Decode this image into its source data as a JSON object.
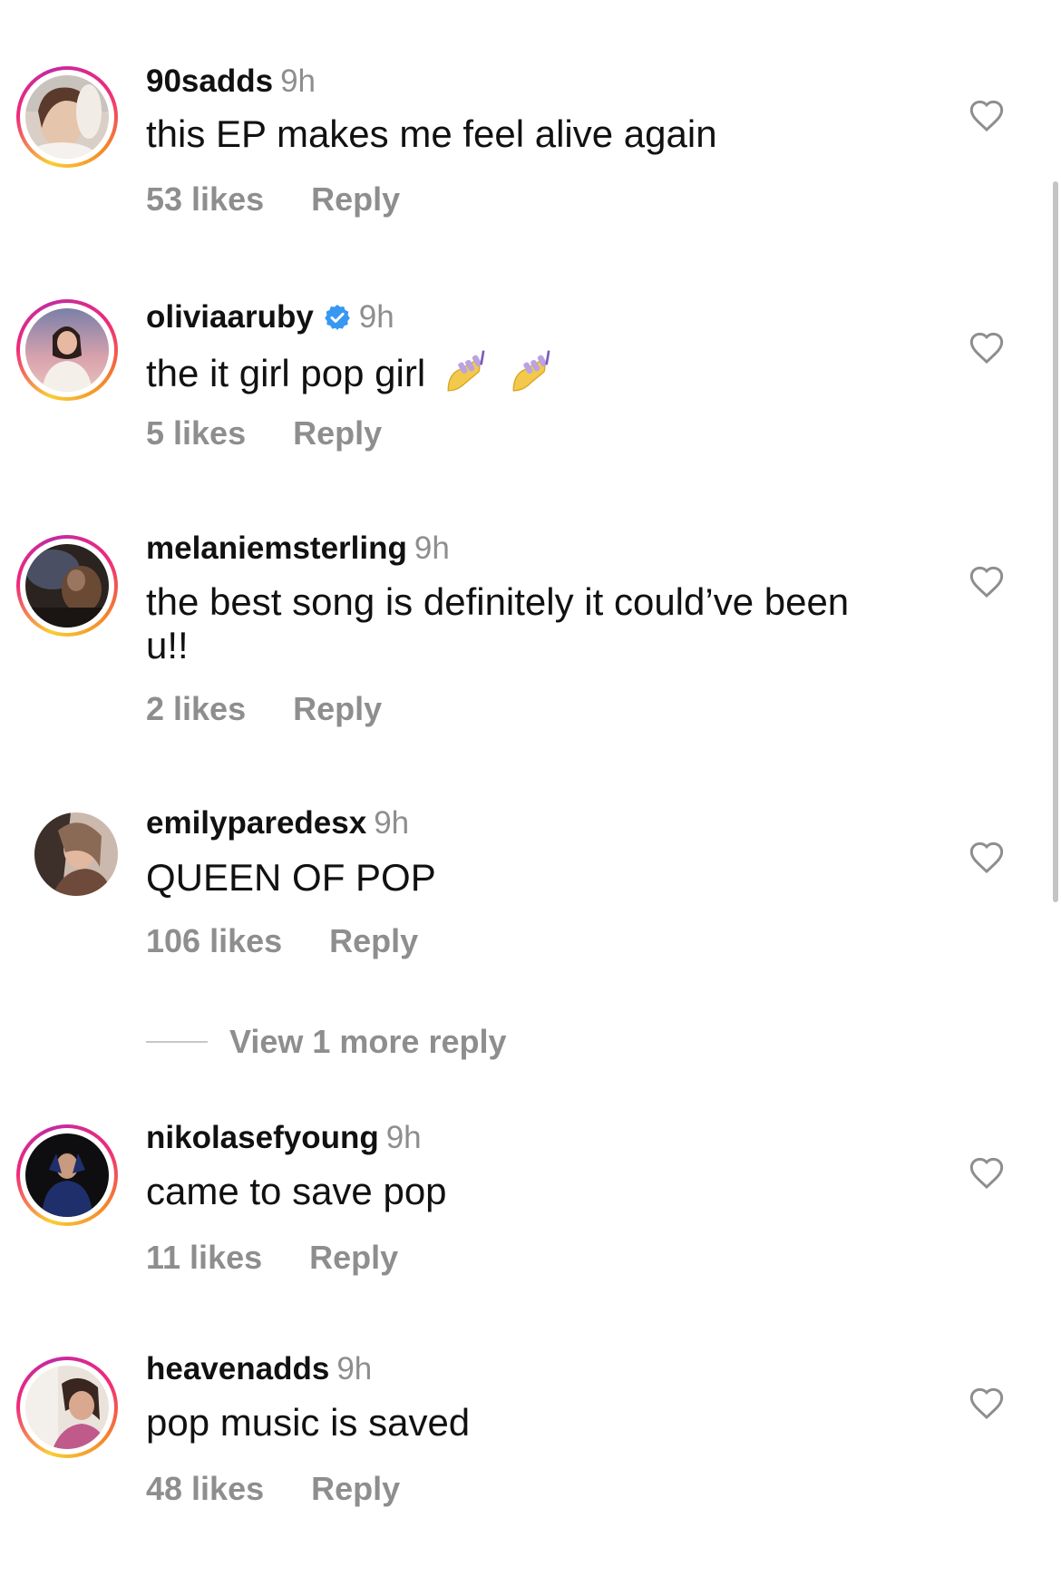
{
  "comments": [
    {
      "username": "90sadds",
      "time": "9h",
      "verified": false,
      "text": "this EP makes me feel alive again",
      "likes": "53 likes",
      "reply": "Reply",
      "story_ring": true
    },
    {
      "username": "oliviaaruby",
      "time": "9h",
      "verified": true,
      "text": "the it girl pop girl",
      "emoji": [
        "nail-polish-icon",
        "nail-polish-icon"
      ],
      "likes": "5 likes",
      "reply": "Reply",
      "story_ring": true
    },
    {
      "username": "melaniemsterling",
      "time": "9h",
      "verified": false,
      "text": "the best song is definitely it could’ve been u!!",
      "likes": "2 likes",
      "reply": "Reply",
      "story_ring": true
    },
    {
      "username": "emilyparedesx",
      "time": "9h",
      "verified": false,
      "text": "QUEEN OF POP",
      "likes": "106 likes",
      "reply": "Reply",
      "story_ring": false,
      "view_more": "View 1 more reply"
    },
    {
      "username": "nikolasefyoung",
      "time": "9h",
      "verified": false,
      "text": "came to save pop",
      "likes": "11 likes",
      "reply": "Reply",
      "story_ring": true
    },
    {
      "username": "heavenadds",
      "time": "9h",
      "verified": false,
      "text": "pop music is saved",
      "likes": "48 likes",
      "reply": "Reply",
      "story_ring": true
    }
  ],
  "colors": {
    "secondary_text": "#8e8e8e",
    "primary_text": "#111111",
    "verified_blue": "#3897f0",
    "story_ring": [
      "#f9ce34",
      "#ee2a7b",
      "#c32aa3"
    ]
  }
}
